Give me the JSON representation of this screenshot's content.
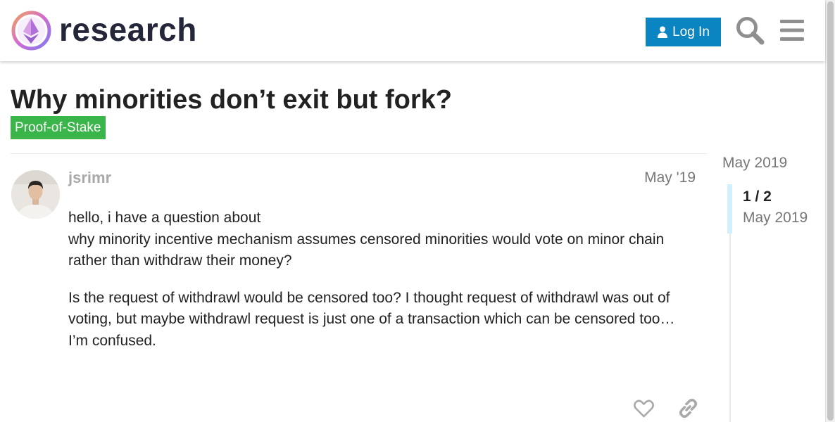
{
  "header": {
    "brand": "research",
    "login_label": "Log In"
  },
  "topic": {
    "title": "Why minorities don’t exit but fork?",
    "category": "Proof-of-Stake"
  },
  "post": {
    "username": "jsrimr",
    "date": "May '19",
    "paragraph1_line1": "hello, i have a question about",
    "paragraph1_line2": "why minority incentive mechanism assumes censored minorities would vote on minor chain rather than withdraw their money?",
    "paragraph2": "Is the request of withdrawl would be censored too? I thought request of withdrawl was out of voting, but maybe withdrawl request is just one of a transaction which can be censored too… I’m confused."
  },
  "timeline": {
    "start_date": "May 2019",
    "count": "1 / 2",
    "current_date": "May 2019"
  },
  "colors": {
    "accent": "#0a85c2",
    "category": "#3ab54a",
    "timeline_handle": "#d1f0ff"
  },
  "icons": {
    "logo": "ethereum-logo-icon",
    "login": "user-icon",
    "search": "search-icon",
    "menu": "hamburger-menu-icon",
    "like": "heart-icon",
    "share": "link-icon"
  }
}
